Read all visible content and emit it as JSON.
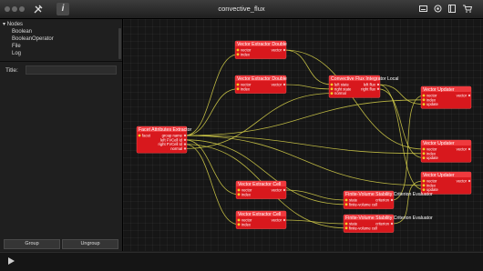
{
  "window": {
    "title": "convective_flux"
  },
  "sidebar": {
    "tree": {
      "root": "Nodes",
      "items": [
        "Boolean",
        "BooleanOperator",
        "File",
        "Log"
      ]
    },
    "title_label": "Title:",
    "buttons": {
      "group": "Group",
      "ungroup": "Ungroup"
    }
  },
  "toolbar_icons": [
    "traffic-light-buttons",
    "tools-icon",
    "info-icon",
    "keyboard-icon",
    "eye-icon",
    "panel-icon",
    "cart-icon"
  ],
  "graph": {
    "nodes": [
      {
        "title": "Facet Attributes Extractor",
        "inputs": [
          "facet"
        ],
        "outputs": [
          "group name",
          "left FVCell Id",
          "right FVCell Id",
          "normal"
        ]
      },
      {
        "title": "Vector Extractor Double",
        "inputs": [
          "vector",
          "index"
        ],
        "outputs": [
          "vector"
        ]
      },
      {
        "title": "Vector Extractor Double",
        "inputs": [
          "vector",
          "index"
        ],
        "outputs": [
          "vector"
        ]
      },
      {
        "title": "Convective Flux Integrator Local",
        "inputs": [
          "left state",
          "right state",
          "normal"
        ],
        "outputs": [
          "left flux",
          "right flux"
        ]
      },
      {
        "title": "Vector Updater",
        "inputs": [
          "vector",
          "index",
          "update"
        ],
        "outputs": [
          "vector"
        ]
      },
      {
        "title": "Vector Updater",
        "inputs": [
          "vector",
          "index",
          "update"
        ],
        "outputs": [
          "vector"
        ]
      },
      {
        "title": "Vector Updater",
        "inputs": [
          "vector",
          "index",
          "update"
        ],
        "outputs": [
          "vector"
        ]
      },
      {
        "title": "Vector Extractor Cell",
        "inputs": [
          "vector",
          "index"
        ],
        "outputs": [
          "vector"
        ]
      },
      {
        "title": "Vector Extractor Cell",
        "inputs": [
          "vector",
          "index"
        ],
        "outputs": [
          "vector"
        ]
      },
      {
        "title": "Finite-Volume Stability Criterion Evaluator",
        "inputs": [
          "state",
          "finite-volume cell"
        ],
        "outputs": [
          "criterion"
        ]
      },
      {
        "title": "Finite-Volume Stability Criterion Evaluator",
        "inputs": [
          "state",
          "finite-volume cell"
        ],
        "outputs": [
          "criterion"
        ]
      }
    ],
    "edges": [
      [
        0,
        0,
        1,
        1
      ],
      [
        0,
        0,
        2,
        1
      ],
      [
        0,
        3,
        3,
        2
      ],
      [
        0,
        1,
        7,
        1
      ],
      [
        0,
        2,
        8,
        1
      ],
      [
        0,
        1,
        9,
        1
      ],
      [
        0,
        2,
        10,
        1
      ],
      [
        0,
        0,
        4,
        1
      ],
      [
        0,
        0,
        5,
        1
      ],
      [
        0,
        0,
        6,
        1
      ],
      [
        1,
        0,
        3,
        0
      ],
      [
        2,
        0,
        3,
        1
      ],
      [
        3,
        0,
        4,
        2
      ],
      [
        3,
        1,
        5,
        2
      ],
      [
        3,
        0,
        6,
        2
      ],
      [
        7,
        0,
        9,
        0
      ],
      [
        8,
        0,
        10,
        0
      ],
      [
        9,
        0,
        4,
        0
      ],
      [
        10,
        0,
        6,
        0
      ],
      [
        1,
        0,
        5,
        0
      ]
    ]
  },
  "colors": {
    "node": "#d8181d",
    "wire": "#d8d24a",
    "port": "#f0cf2a"
  }
}
